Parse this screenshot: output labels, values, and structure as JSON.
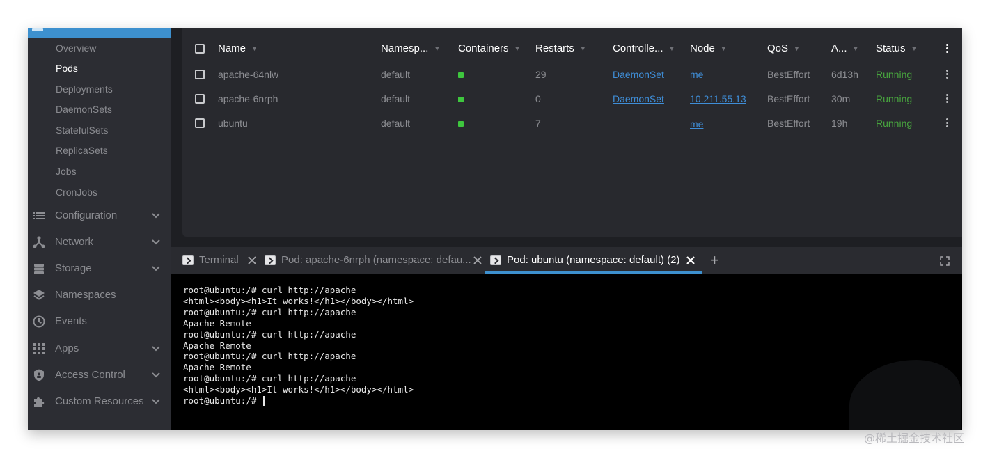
{
  "sidebar": {
    "workloads_sub": [
      "Overview",
      "Pods",
      "Deployments",
      "DaemonSets",
      "StatefulSets",
      "ReplicaSets",
      "Jobs",
      "CronJobs"
    ],
    "active_sub": "Pods",
    "nav": [
      {
        "label": "Configuration",
        "icon": "list-icon",
        "expandable": true
      },
      {
        "label": "Network",
        "icon": "network-icon",
        "expandable": true
      },
      {
        "label": "Storage",
        "icon": "storage-icon",
        "expandable": true
      },
      {
        "label": "Namespaces",
        "icon": "layers-icon",
        "expandable": false
      },
      {
        "label": "Events",
        "icon": "clock-icon",
        "expandable": false
      },
      {
        "label": "Apps",
        "icon": "grid-icon",
        "expandable": true
      },
      {
        "label": "Access Control",
        "icon": "shield-icon",
        "expandable": true
      },
      {
        "label": "Custom Resources",
        "icon": "puzzle-icon",
        "expandable": true
      }
    ]
  },
  "pods_table": {
    "headers": {
      "name": "Name",
      "namespace": "Namesp...",
      "containers": "Containers",
      "restarts": "Restarts",
      "controlled_by": "Controlle...",
      "node": "Node",
      "qos": "QoS",
      "age": "A...",
      "status": "Status"
    },
    "rows": [
      {
        "name": "apache-64nlw",
        "namespace": "default",
        "restarts": "29",
        "controlled_by": "DaemonSet",
        "node": "me",
        "qos": "BestEffort",
        "age": "6d13h",
        "status": "Running"
      },
      {
        "name": "apache-6nrph",
        "namespace": "default",
        "restarts": "0",
        "controlled_by": "DaemonSet",
        "node": "10.211.55.13",
        "qos": "BestEffort",
        "age": "30m",
        "status": "Running"
      },
      {
        "name": "ubuntu",
        "namespace": "default",
        "restarts": "7",
        "controlled_by": "",
        "node": "me",
        "qos": "BestEffort",
        "age": "19h",
        "status": "Running"
      }
    ]
  },
  "dock": {
    "tabs": [
      {
        "label": "Terminal",
        "active": false
      },
      {
        "label": "Pod: apache-6nrph (namespace: defau...",
        "active": false
      },
      {
        "label": "Pod: ubuntu (namespace: default) (2)",
        "active": true
      }
    ],
    "add_label": "+"
  },
  "terminal": {
    "lines": [
      "root@ubuntu:/# curl http://apache",
      "<html><body><h1>It works!</h1></body></html>",
      "root@ubuntu:/# curl http://apache",
      "Apache Remote",
      "root@ubuntu:/# curl http://apache",
      "Apache Remote",
      "root@ubuntu:/# curl http://apache",
      "Apache Remote",
      "root@ubuntu:/# curl http://apache",
      "<html><body><h1>It works!</h1></body></html>",
      "root@ubuntu:/# "
    ]
  },
  "watermark": "@稀土掘金技术社区",
  "colors": {
    "accent": "#3d90ce",
    "running": "#47a23e",
    "container_ok": "#3ec63e",
    "link": "#3f8ed8"
  }
}
